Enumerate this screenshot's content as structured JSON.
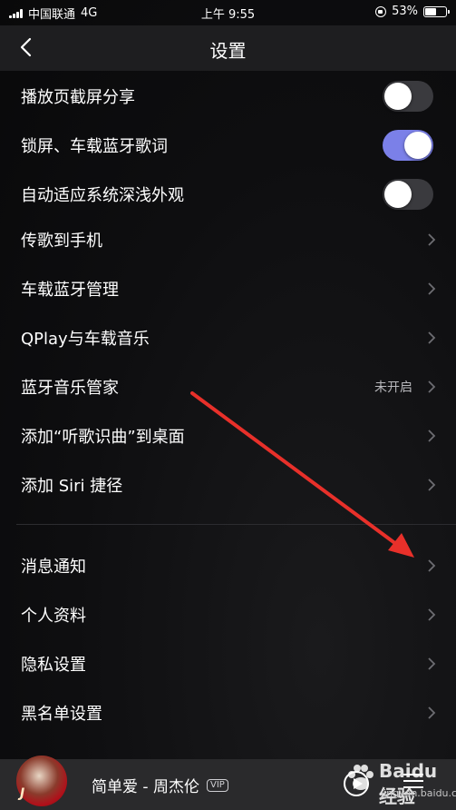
{
  "status_bar": {
    "carrier": "中国联通",
    "network": "4G",
    "time": "上午 9:55",
    "battery": "53%"
  },
  "header": {
    "title": "设置"
  },
  "settings": [
    {
      "label": "播放页截屏分享",
      "type": "toggle",
      "on": false
    },
    {
      "label": "锁屏、车载蓝牙歌词",
      "type": "toggle",
      "on": true
    },
    {
      "label": "自动适应系统深浅外观",
      "type": "toggle",
      "on": false
    },
    {
      "label": "传歌到手机",
      "type": "link"
    },
    {
      "label": "车载蓝牙管理",
      "type": "link"
    },
    {
      "label": "QPlay与车载音乐",
      "type": "link"
    },
    {
      "label": "蓝牙音乐管家",
      "type": "link",
      "value": "未开启"
    },
    {
      "label": "添加“听歌识曲”到桌面",
      "type": "link"
    },
    {
      "label": "添加 Siri 捷径",
      "type": "link"
    },
    {
      "label": "消息通知",
      "type": "link"
    },
    {
      "label": "个人资料",
      "type": "link"
    },
    {
      "label": "隐私设置",
      "type": "link"
    },
    {
      "label": "黑名单设置",
      "type": "link"
    }
  ],
  "player": {
    "song": "简单爱 - 周杰伦",
    "badge": "VIP",
    "cover_text": "J"
  },
  "watermark": {
    "text": "Baidu 经验",
    "sub": "jingyan.baidu.com"
  },
  "colors": {
    "accent": "#7b80e8",
    "arrow": "#e8302a",
    "background": "#0e0e10"
  }
}
